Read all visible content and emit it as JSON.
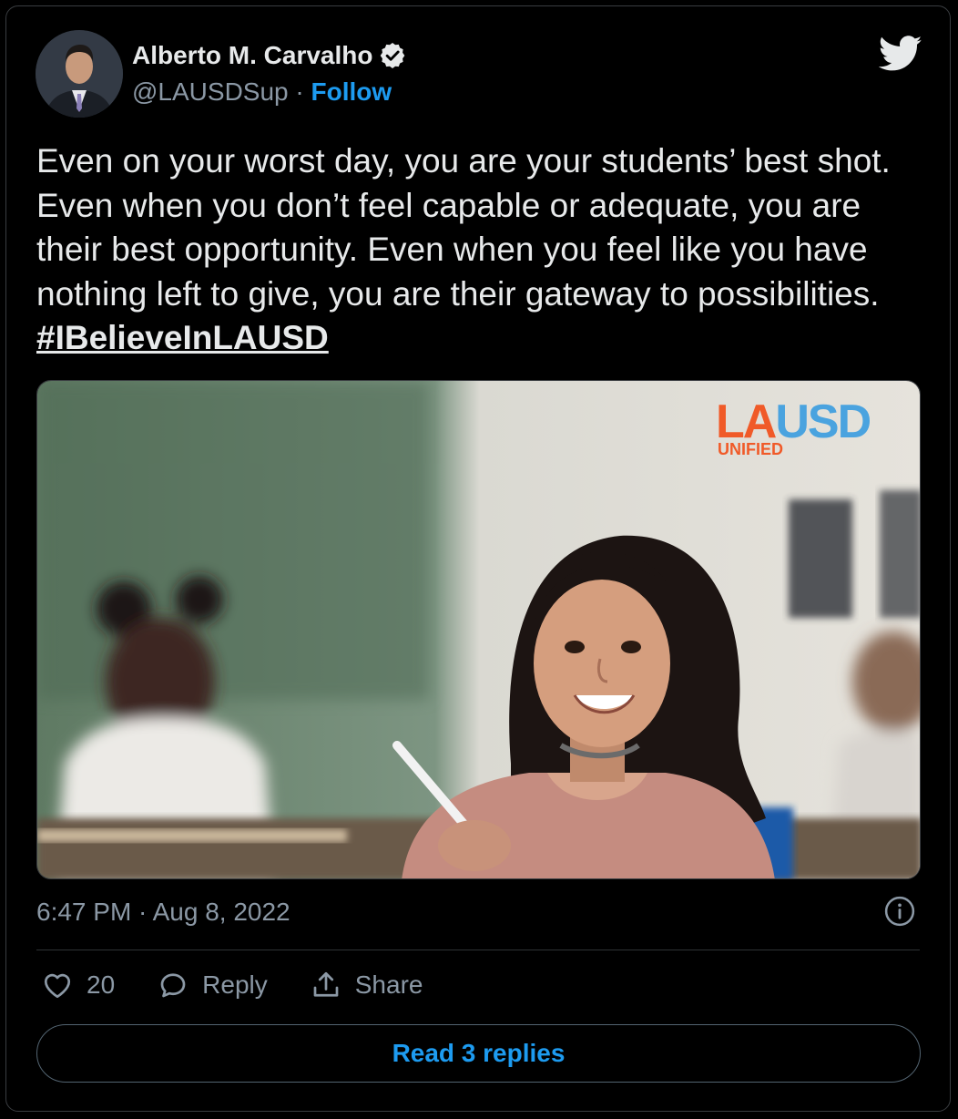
{
  "author": {
    "name": "Alberto M. Carvalho",
    "handle": "@LAUSDSup",
    "separator": "·",
    "follow_label": "Follow"
  },
  "tweet": {
    "text": "Even on your worst day, you are your students’ best shot. Even when you don’t feel capable or adequate, you are their best opportunity. Even when you feel like you have nothing left to give, you are their gateway to possibilities.",
    "hashtag": "#IBelieveInLAUSD",
    "timestamp": "6:47 PM · Aug 8, 2022"
  },
  "media": {
    "logo_main": "LAUSD",
    "logo_sub": "UNIFIED"
  },
  "actions": {
    "likes": "20",
    "reply_label": "Reply",
    "share_label": "Share"
  },
  "footer": {
    "read_replies_label": "Read 3 replies"
  },
  "colors": {
    "accent": "#1d9bf0",
    "background": "#000000",
    "text": "#e7e9ea",
    "muted": "#8b98a5",
    "logo_orange": "#f05a28",
    "logo_blue": "#4aa3df"
  }
}
